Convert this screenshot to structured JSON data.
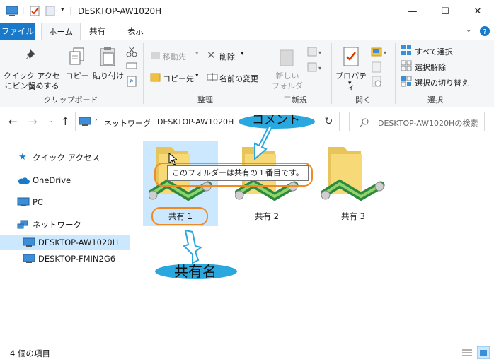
{
  "window": {
    "title": "DESKTOP-AW1020H",
    "minimize": "—",
    "maximize": "☐",
    "close": "✕"
  },
  "tabs": [
    {
      "label": "ファイル"
    },
    {
      "label": "ホーム"
    },
    {
      "label": "共有"
    },
    {
      "label": "表示"
    }
  ],
  "ribbon": {
    "clipboard": {
      "pin_label_1": "クイック アクセス",
      "pin_label_2": "にピン留めする",
      "copy": "コピー",
      "paste": "貼り付け",
      "group": "クリップボード"
    },
    "organize": {
      "move_to": "移動先",
      "copy_to": "コピー先",
      "delete": "削除",
      "rename": "名前の変更",
      "group": "整理"
    },
    "new": {
      "folder_1": "新しい",
      "folder_2": "フォルダー",
      "group": "新規"
    },
    "open": {
      "properties": "プロパティ",
      "group": "開く"
    },
    "select": {
      "all": "すべて選択",
      "none": "選択解除",
      "invert": "選択の切り替え",
      "group": "選択"
    }
  },
  "address": {
    "crumb_1": "ネットワーク",
    "crumb_2": "DESKTOP-AW1020H",
    "search_placeholder": "DESKTOP-AW1020Hの検索"
  },
  "nav": {
    "quick_access": "クイック アクセス",
    "onedrive": "OneDrive",
    "pc": "PC",
    "network": "ネットワーク",
    "host_1": "DESKTOP-AW1020H",
    "host_2": "DESKTOP-FMIN2G6"
  },
  "shares": [
    {
      "label": "共有 1"
    },
    {
      "label": "共有 2"
    },
    {
      "label": "共有 3"
    }
  ],
  "tooltip": "このフォルダーは共有の１番目です。",
  "annotations": {
    "comment": "コメント",
    "share_name": "共有名"
  },
  "status": {
    "count": "4 個の項目"
  },
  "colors": {
    "file_tab": "#1979ca",
    "selected": "#cce8ff",
    "annotation_orange": "#f08a24",
    "annotation_blue": "#29a8e0"
  }
}
